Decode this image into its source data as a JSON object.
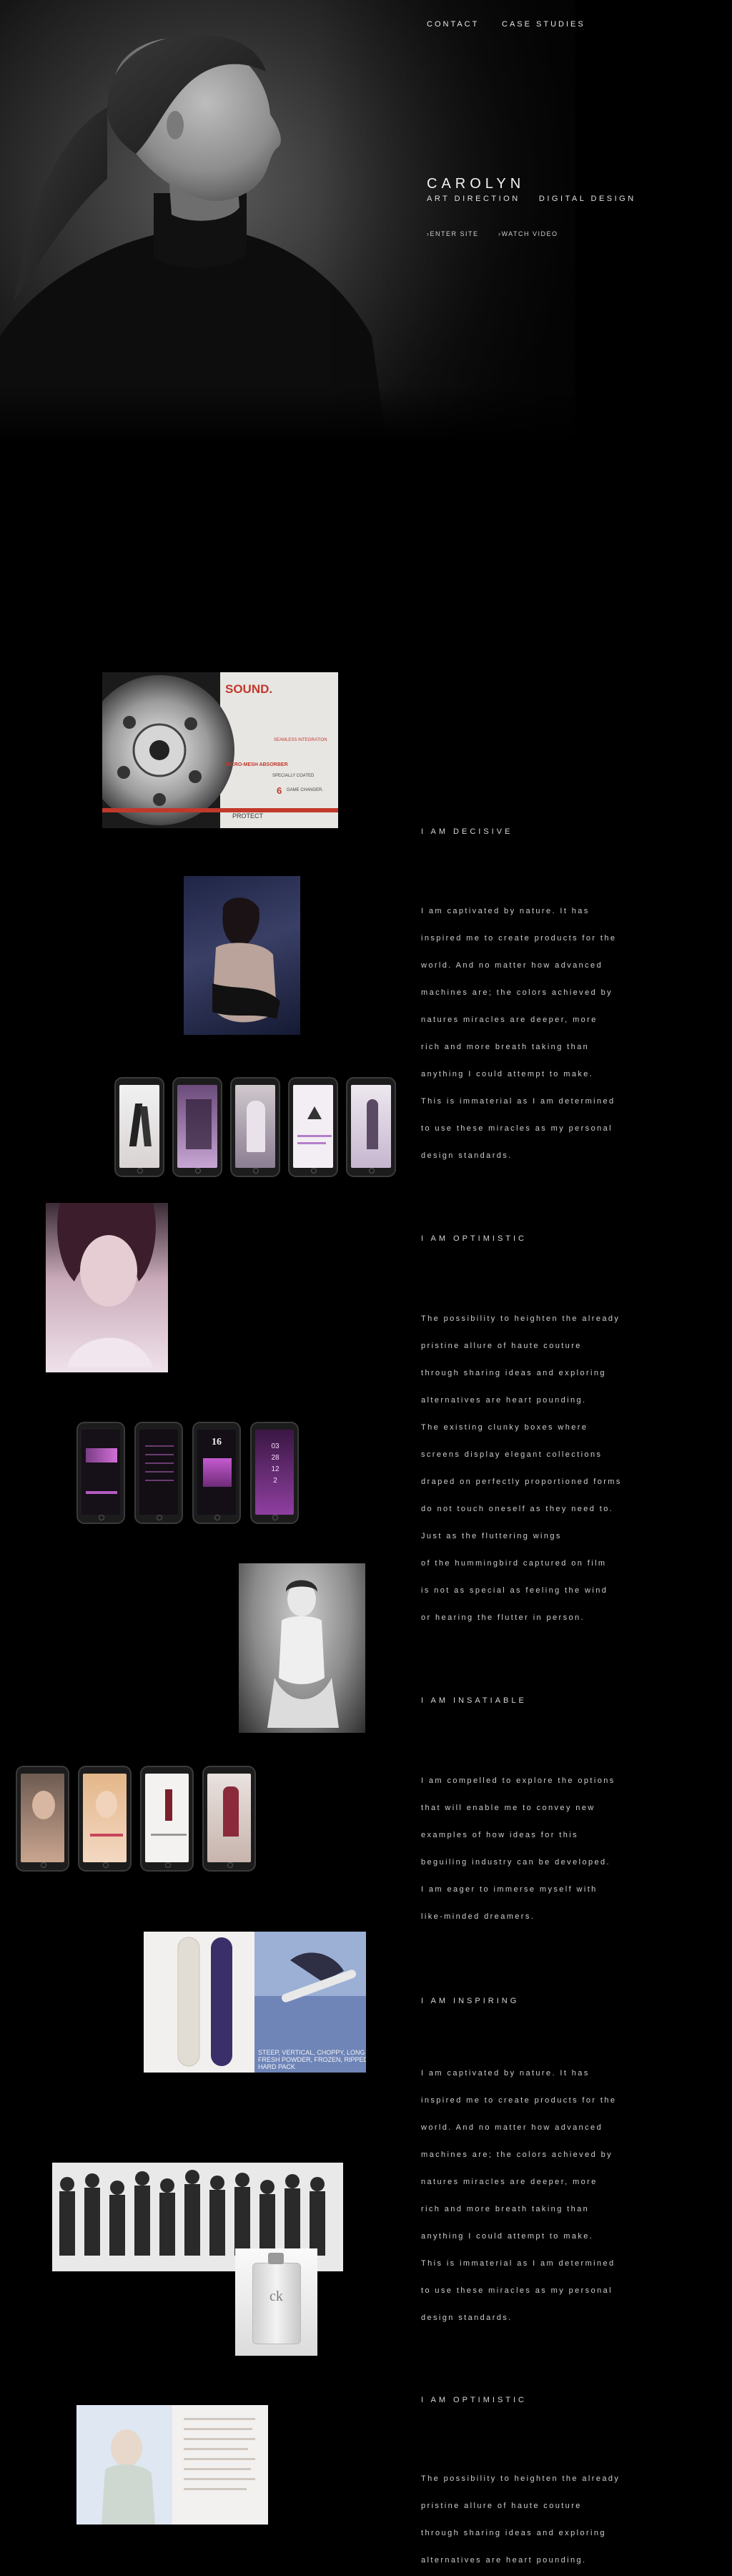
{
  "nav": {
    "contact": "CONTACT",
    "case_studies": "CASE STUDIES"
  },
  "hero": {
    "name": "CAROLYN",
    "tagline": "ART DIRECTION    DIGITAL DESIGN",
    "enter_site": "›ENTER SITE",
    "watch_video": "›WATCH VIDEO"
  },
  "sound_ad": {
    "headline": "SOUND.",
    "label_1": "SEAMLESS INTEGRATION",
    "label_2": "MICRO-MESH ABSORBER",
    "label_3": "SPECIALLY COATED",
    "label_4": "GAME CHANGER.",
    "label_5": "PROTECT",
    "number": "6"
  },
  "app_screen": {
    "date": "16",
    "countdown": "03 28 12 2"
  },
  "snowboard_ad": {
    "line_1": "STEEP, VERTICAL, CHOPPY, LONG",
    "line_2": "FRESH POWDER, FROZEN, RIPPED",
    "line_3": "HARD PACK"
  },
  "fragrance": {
    "bottle_mark": "ck"
  },
  "sections": [
    {
      "heading": "I AM DECISIVE",
      "lines": [
        "I am captivated by nature. It has",
        "inspired me to create products for the",
        "world. And no matter how advanced",
        "machines are; the colors achieved by",
        "natures miracles are deeper, more",
        "rich and more breath taking than",
        "anything I could attempt to make.",
        "This is immaterial as I am determined",
        "to use these miracles as my personal",
        "design standards."
      ]
    },
    {
      "heading": "I AM OPTIMISTIC",
      "lines": [
        "The possibility to heighten the already",
        "pristine allure of haute couture",
        "through sharing ideas and exploring",
        "alternatives are heart pounding.",
        "The existing clunky boxes where",
        "screens display elegant collections",
        "draped on perfectly proportioned forms",
        "do not touch oneself as they need to.",
        "Just as the fluttering wings",
        "of the hummingbird captured on film",
        "is not as special as feeling the wind",
        "or hearing the flutter in person."
      ]
    },
    {
      "heading": "I AM INSATIABLE",
      "lines": [
        "I am compelled to explore the options",
        "that will enable me to convey new",
        "examples of how ideas for this",
        "beguiling industry can be developed.",
        "I am eager to immerse myself with",
        "like-minded dreamers."
      ]
    },
    {
      "heading": "I AM INSPIRING",
      "lines": [
        "I am captivated by nature. It has",
        "inspired me to create products for the",
        "world. And no matter how advanced",
        "machines are; the colors achieved by",
        "natures miracles are deeper, more",
        "rich and more breath taking than",
        "anything I could attempt to make.",
        "This is immaterial as I am determined",
        "to use these miracles as my personal",
        "design standards."
      ]
    },
    {
      "heading": "I AM OPTIMISTIC",
      "lines": [
        "The possibility to heighten the already",
        "pristine allure of haute couture",
        "through sharing ideas and exploring",
        "alternatives are heart pounding."
      ]
    }
  ]
}
